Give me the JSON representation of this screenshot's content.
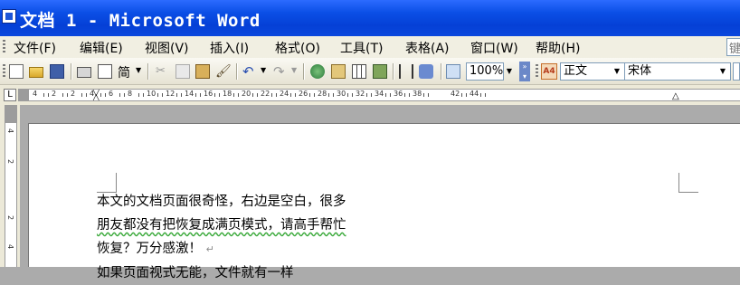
{
  "window": {
    "title": "文档 1 - Microsoft Word"
  },
  "menu": {
    "items": [
      "文件(F)",
      "编辑(E)",
      "视图(V)",
      "插入(I)",
      "格式(O)",
      "工具(T)",
      "表格(A)",
      "窗口(W)",
      "帮助(H)"
    ],
    "help_box_text": "键"
  },
  "toolbar": {
    "font_size_menu": "简",
    "zoom": "100%",
    "style": "正文",
    "font": "宋体",
    "style_icon_text": "A4"
  },
  "ruler": {
    "tab_selector": "L",
    "labels": [
      "4",
      "2",
      "2",
      "4",
      "6",
      "8",
      "10",
      "12",
      "14",
      "16",
      "18",
      "20",
      "22",
      "24",
      "26",
      "28",
      "30",
      "32",
      "34",
      "36",
      "38",
      "42",
      "44"
    ],
    "vertical_labels": [
      "4",
      "2",
      "2",
      "4"
    ]
  },
  "document": {
    "lines": [
      "本文的文档页面很奇怪，右边是空白，很多",
      "朋友都没有把恢复成满页模式，请高手帮忙",
      "恢复？万分感激！"
    ],
    "line3_partial": "如果页面视式无能，文件就有一样",
    "paragraph_mark": "↵"
  },
  "colors": {
    "titlebar": "#0a47dd",
    "menubar": "#f1efe2",
    "doc_background": "#ababab"
  }
}
